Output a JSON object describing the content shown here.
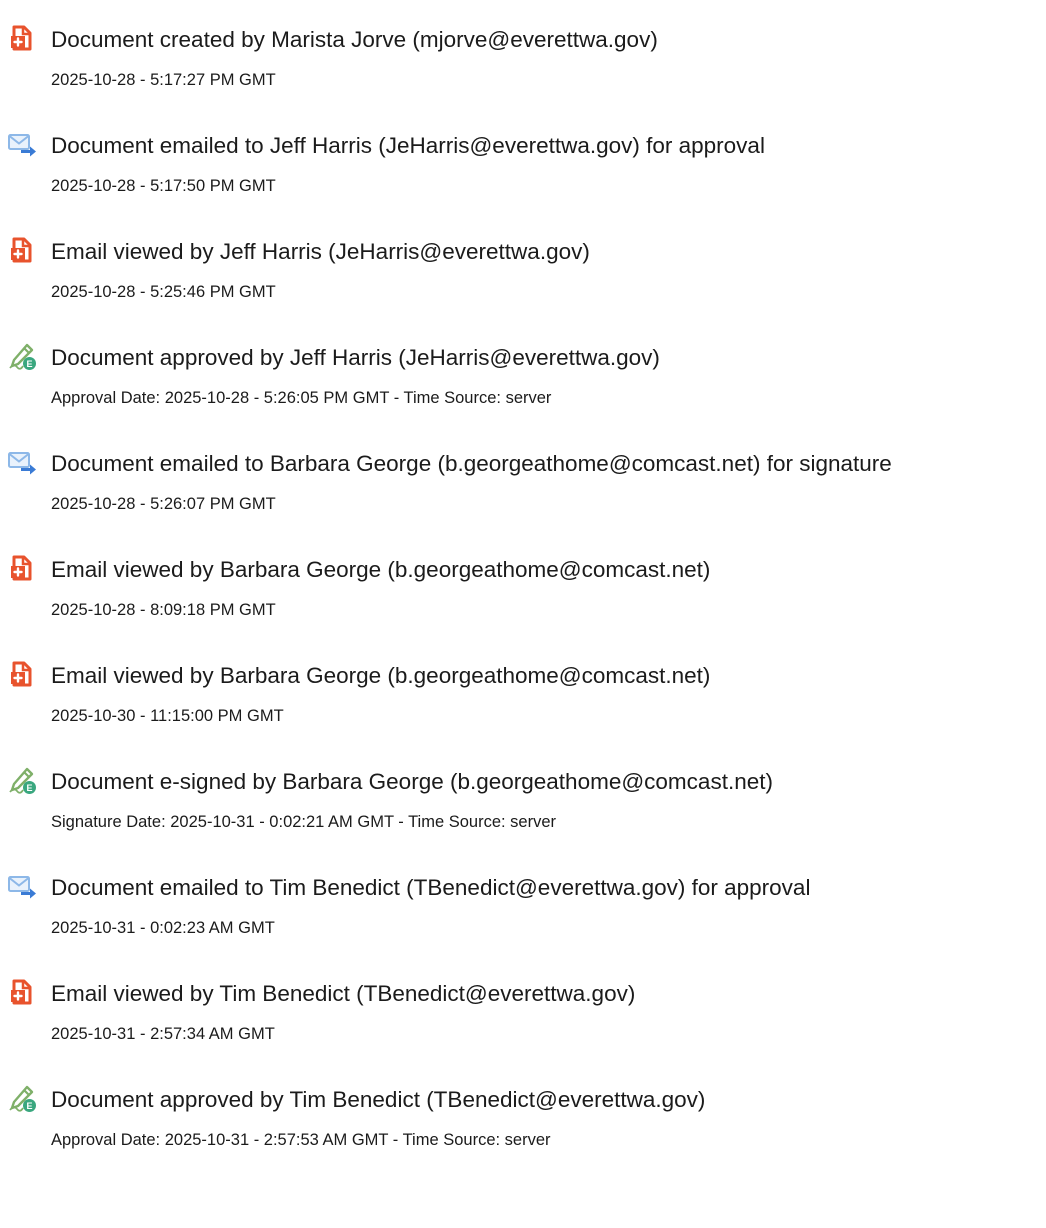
{
  "colors": {
    "created_viewed_icon": "#e8532d",
    "email_icon_envelope": "#8db8e8",
    "email_icon_arrow": "#3a7bd5",
    "pen_icon": "#7fb069",
    "pen_icon_badge": "#3aa77f",
    "text": "#1b1b1b"
  },
  "events": [
    {
      "icon": "document-created-icon",
      "title": "Document created by Marista Jorve (mjorve@everettwa.gov)",
      "detail": "2025-10-28 - 5:17:27 PM GMT"
    },
    {
      "icon": "email-sent-icon",
      "title": "Document emailed to Jeff Harris (JeHarris@everettwa.gov) for approval",
      "detail": "2025-10-28 - 5:17:50 PM GMT"
    },
    {
      "icon": "document-viewed-icon",
      "title": "Email viewed by Jeff Harris (JeHarris@everettwa.gov)",
      "detail": "2025-10-28 - 5:25:46 PM GMT"
    },
    {
      "icon": "approval-pen-icon",
      "title": "Document approved by Jeff Harris (JeHarris@everettwa.gov)",
      "detail": "Approval Date: 2025-10-28 - 5:26:05 PM GMT - Time Source: server"
    },
    {
      "icon": "email-sent-icon",
      "title": "Document emailed to Barbara George (b.georgeathome@comcast.net) for signature",
      "detail": "2025-10-28 - 5:26:07 PM GMT"
    },
    {
      "icon": "document-viewed-icon",
      "title": "Email viewed by Barbara George (b.georgeathome@comcast.net)",
      "detail": "2025-10-28 - 8:09:18 PM GMT"
    },
    {
      "icon": "document-viewed-icon",
      "title": "Email viewed by Barbara George (b.georgeathome@comcast.net)",
      "detail": "2025-10-30 - 11:15:00 PM GMT"
    },
    {
      "icon": "signature-pen-icon",
      "title": "Document e-signed by Barbara George (b.georgeathome@comcast.net)",
      "detail": "Signature Date: 2025-10-31 - 0:02:21 AM GMT - Time Source: server"
    },
    {
      "icon": "email-sent-icon",
      "title": "Document emailed to Tim Benedict (TBenedict@everettwa.gov) for approval",
      "detail": "2025-10-31 - 0:02:23 AM GMT"
    },
    {
      "icon": "document-viewed-icon",
      "title": "Email viewed by Tim Benedict (TBenedict@everettwa.gov)",
      "detail": "2025-10-31 - 2:57:34 AM GMT"
    },
    {
      "icon": "approval-pen-icon",
      "title": "Document approved by Tim Benedict (TBenedict@everettwa.gov)",
      "detail": "Approval Date: 2025-10-31 - 2:57:53 AM GMT - Time Source: server"
    }
  ]
}
